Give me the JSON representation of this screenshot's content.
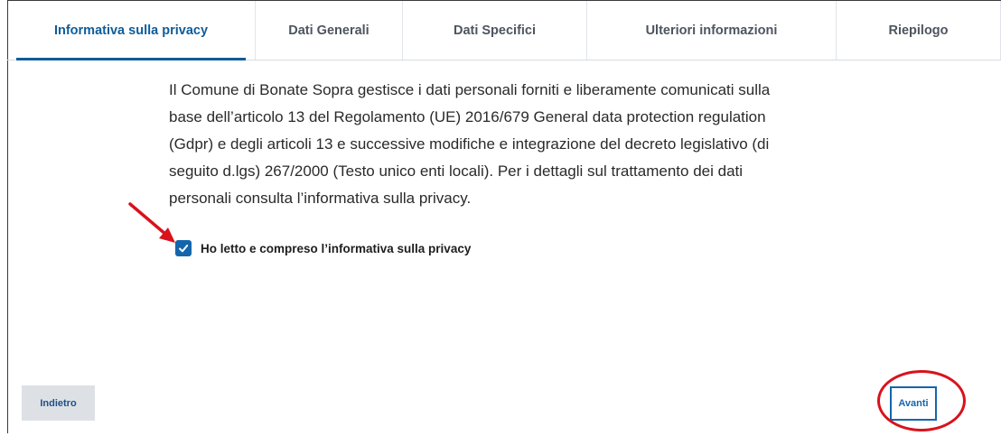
{
  "tabs": [
    {
      "label": "Informativa sulla privacy",
      "active": true
    },
    {
      "label": "Dati Generali",
      "active": false
    },
    {
      "label": "Dati Specifici",
      "active": false
    },
    {
      "label": "Ulteriori informazioni",
      "active": false
    },
    {
      "label": "Riepilogo",
      "active": false
    }
  ],
  "privacy": {
    "text": "Il Comune di Bonate Sopra gestisce i dati personali forniti e liberamente comunicati sulla base dell’articolo 13 del Regolamento (UE) 2016/679 General data protection regulation (Gdpr) e degli articoli 13 e successive modifiche e integrazione del decreto legislativo (di seguito d.lgs) 267/2000 (Testo unico enti locali). Per i dettagli sul trattamento dei dati personali consulta l’informativa sulla privacy.",
    "checkbox_label": "Ho letto e compreso l’informativa sulla privacy",
    "checkbox_checked": true
  },
  "actions": {
    "back_label": "Indietro",
    "next_label": "Avanti"
  },
  "annotations": {
    "arrow_icon": "red-arrow-icon",
    "highlight_icon": "red-ellipse-highlight",
    "color": "#d9121b"
  },
  "colors": {
    "accent": "#0f5c99",
    "checkbox": "#1466ac",
    "back_button_bg": "#dde1e6"
  }
}
